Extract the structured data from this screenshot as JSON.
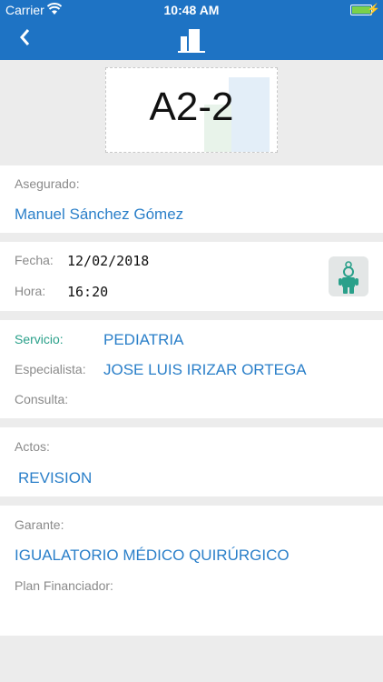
{
  "status_bar": {
    "carrier": "Carrier",
    "time": "10:48 AM"
  },
  "nav": {
    "back_icon": "chevron-left-icon",
    "logo_icon": "building-icon"
  },
  "ticket": {
    "code": "A2-2"
  },
  "insured": {
    "label": "Asegurado:",
    "name": "Manuel Sánchez Gómez"
  },
  "appointment": {
    "date_label": "Fecha:",
    "date": "12/02/2018",
    "time_label": "Hora:",
    "time": "16:20",
    "icon": "pediatrics-child-icon"
  },
  "service": {
    "service_label": "Servicio:",
    "service": "PEDIATRIA",
    "specialist_label": "Especialista:",
    "specialist": "JOSE LUIS IRIZAR ORTEGA",
    "office_label": "Consulta:"
  },
  "acts": {
    "label": "Actos:",
    "value": "REVISION"
  },
  "guarantor": {
    "label": "Garante:",
    "value": "IGUALATORIO MÉDICO QUIRÚRGICO",
    "plan_label": "Plan Financiador:"
  },
  "colors": {
    "primary": "#1e73c4",
    "link": "#2a7fc9",
    "teal": "#2aa08a"
  }
}
